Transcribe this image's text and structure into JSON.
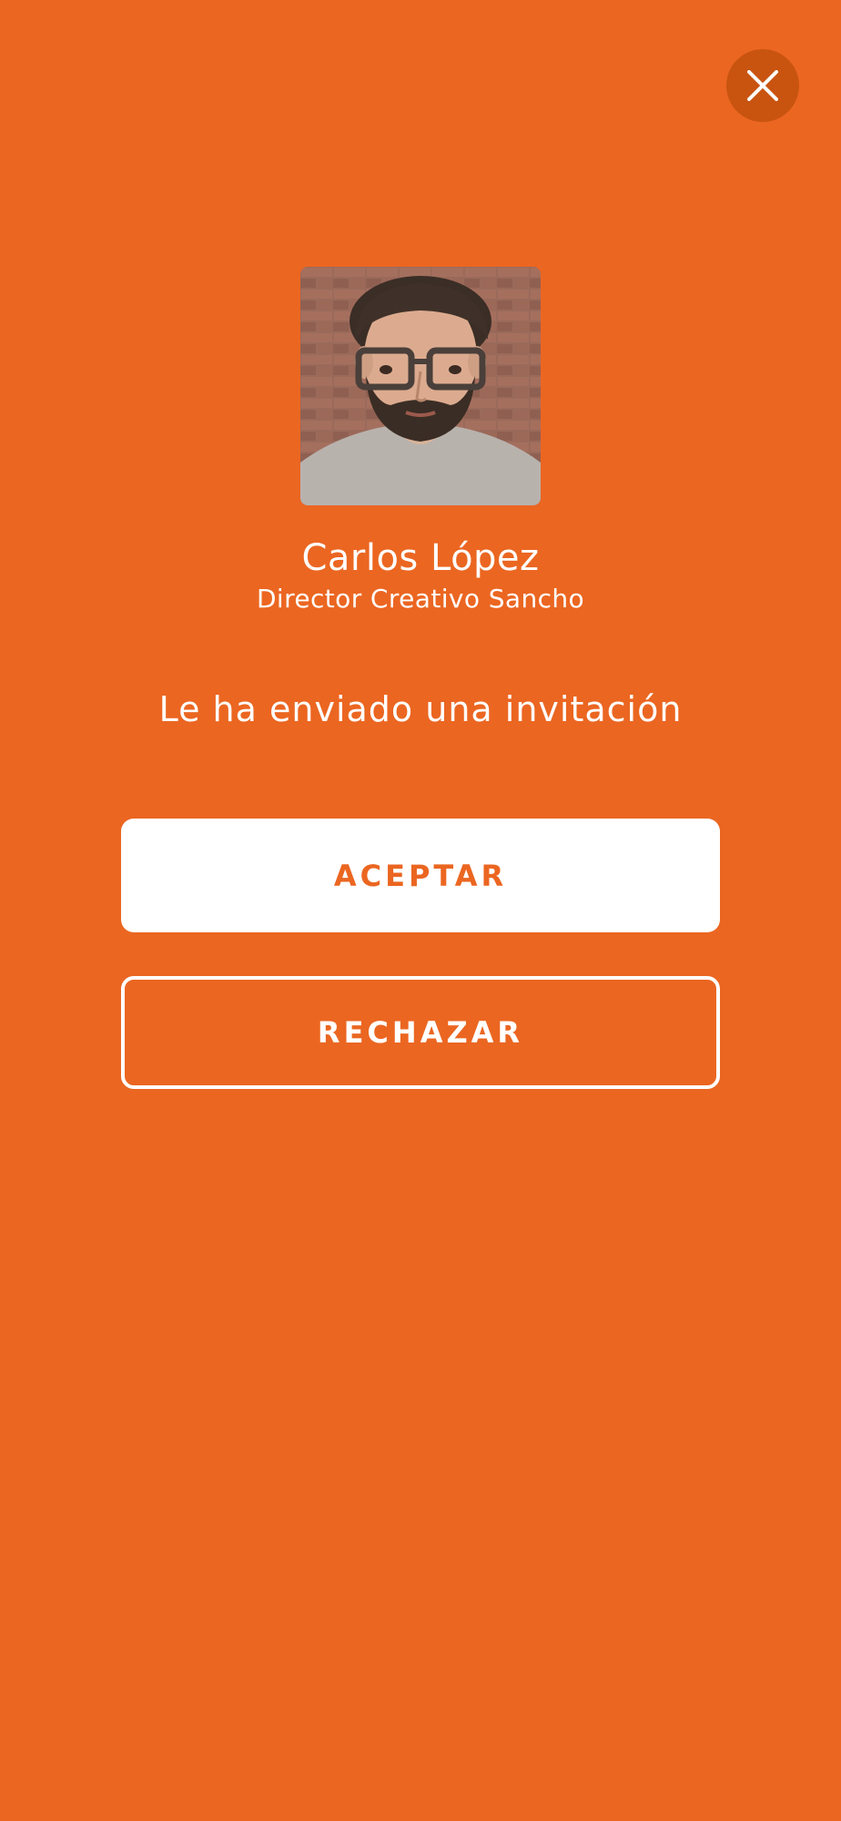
{
  "colors": {
    "background": "#EB6621",
    "close_button": "#C85410",
    "accept_text": "#EB6621",
    "text": "#FFFFFF"
  },
  "close": {
    "icon": "close-icon"
  },
  "profile": {
    "name": "Carlos López",
    "role": "Director Creativo Sancho"
  },
  "message": "Le ha enviado una invitación",
  "actions": {
    "accept_label": "ACEPTAR",
    "reject_label": "RECHAZAR"
  }
}
